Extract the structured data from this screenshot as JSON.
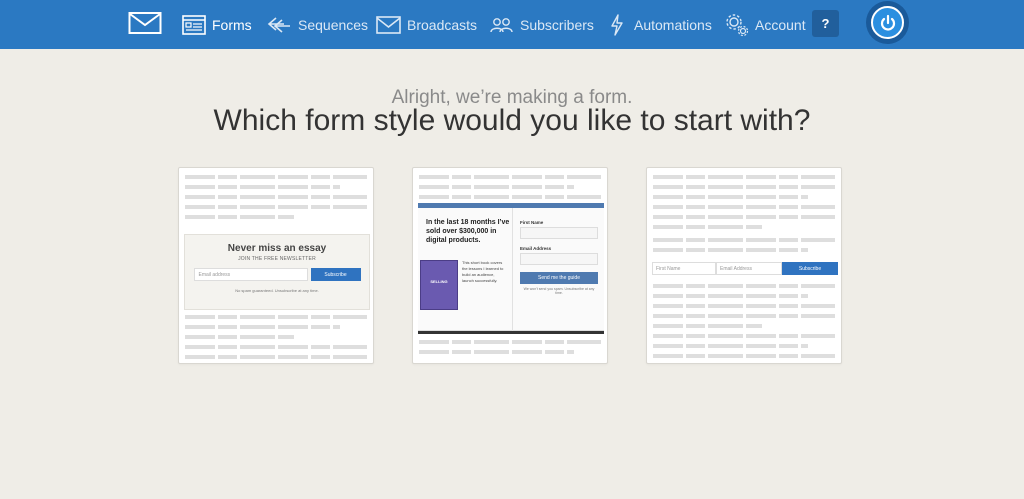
{
  "nav": {
    "logo_icon": "envelope-icon",
    "items": [
      {
        "label": "Forms",
        "icon": "form-icon"
      },
      {
        "label": "Sequences",
        "icon": "sequence-arrows-icon"
      },
      {
        "label": "Broadcasts",
        "icon": "envelope-icon"
      },
      {
        "label": "Subscribers",
        "icon": "people-icon"
      },
      {
        "label": "Automations",
        "icon": "lightning-icon"
      },
      {
        "label": "Account",
        "icon": "gears-icon"
      }
    ],
    "help_label": "?",
    "power_icon": "power-icon",
    "colors": {
      "bar": "#2b79c2",
      "text": "#dbe8f5"
    }
  },
  "subtitle": "Alright, we’re making a form.",
  "title": "Which form style would you like to start with?",
  "cards": [
    {
      "heading": "Never miss an essay",
      "subheading": "JOIN THE FREE NEWSLETTER",
      "email_placeholder": "Email address",
      "button": "Subscribe",
      "fine_print": "No spam guaranteed. Unsubscribe at any time."
    },
    {
      "heading": "In the last 18 months I’ve sold over $300,000 in digital products.",
      "book_title": "SELLING",
      "blurb": "This short book covers the lessons I learned to build an audience, launch successfully.",
      "first_name_label": "First Name",
      "email_label": "Email Address",
      "button": "Send me the guide",
      "fine_print": "We won't send you spam. Unsubscribe at any time."
    },
    {
      "first_name_placeholder": "First Name",
      "email_placeholder": "Email Address",
      "button": "Subscribe"
    }
  ]
}
